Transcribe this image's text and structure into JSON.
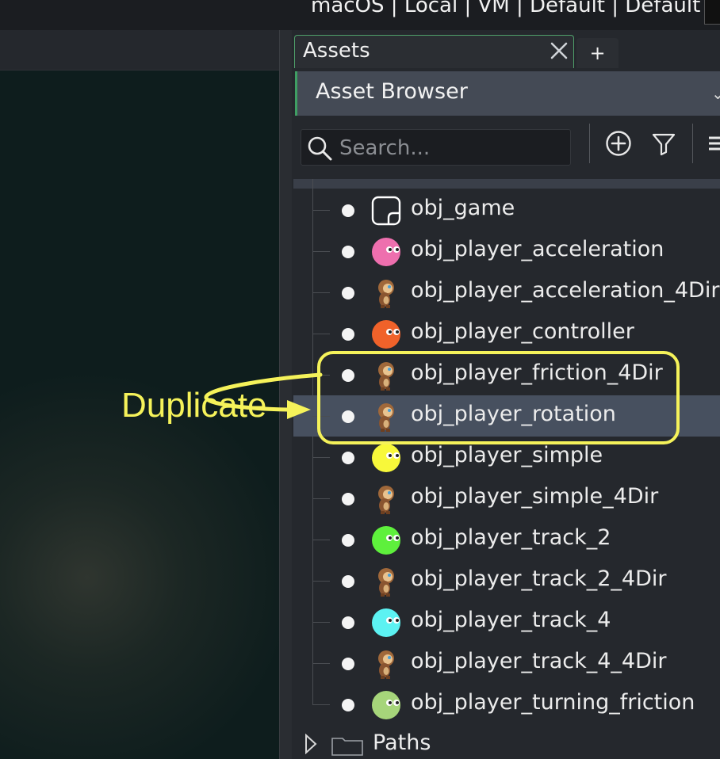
{
  "topbar": {
    "target_text": "macOS | Local | VM | Default | Default"
  },
  "tabs": {
    "assets_label": "Assets",
    "add_label": "+"
  },
  "browser": {
    "title": "Asset Browser"
  },
  "search": {
    "placeholder": "Search..."
  },
  "tree": {
    "items": [
      {
        "label": "obj_game",
        "icon": "object-placeholder-icon",
        "color": "#ffffff"
      },
      {
        "label": "obj_player_acceleration",
        "icon": "blob-sprite-icon",
        "color": "#ee6fae"
      },
      {
        "label": "obj_player_acceleration_4Dir",
        "icon": "monkey-sprite-icon",
        "color": "#a0683a"
      },
      {
        "label": "obj_player_controller",
        "icon": "blob-sprite-icon",
        "color": "#f0622a"
      },
      {
        "label": "obj_player_friction_4Dir",
        "icon": "monkey-sprite-icon",
        "color": "#a0683a"
      },
      {
        "label": "obj_player_rotation",
        "icon": "monkey-sprite-icon",
        "color": "#a0683a",
        "selected": true
      },
      {
        "label": "obj_player_simple",
        "icon": "blob-sprite-icon",
        "color": "#f8f83a"
      },
      {
        "label": "obj_player_simple_4Dir",
        "icon": "monkey-sprite-icon",
        "color": "#a0683a"
      },
      {
        "label": "obj_player_track_2",
        "icon": "blob-sprite-icon",
        "color": "#5ef03c"
      },
      {
        "label": "obj_player_track_2_4Dir",
        "icon": "monkey-sprite-icon",
        "color": "#a0683a"
      },
      {
        "label": "obj_player_track_4",
        "icon": "blob-sprite-icon",
        "color": "#5cf2f2"
      },
      {
        "label": "obj_player_track_4_4Dir",
        "icon": "monkey-sprite-icon",
        "color": "#a0683a"
      },
      {
        "label": "obj_player_turning_friction",
        "icon": "blob-sprite-icon",
        "color": "#a6d57a"
      }
    ],
    "paths_label": "Paths"
  },
  "annotation": {
    "text": "Duplicate",
    "color": "#f5f25a"
  }
}
